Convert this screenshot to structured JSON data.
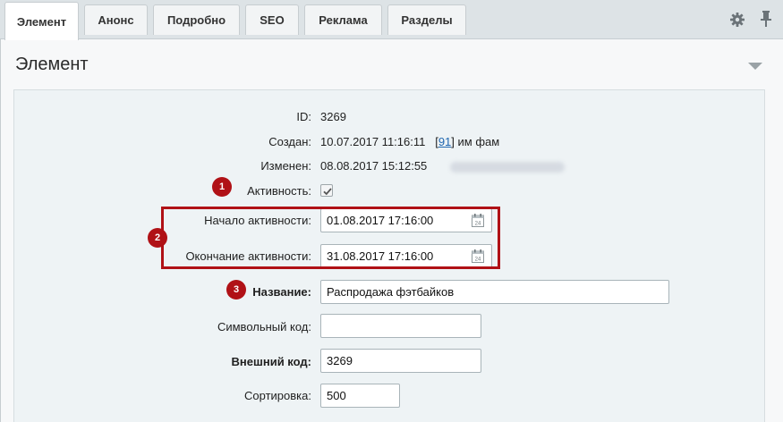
{
  "tabs": [
    {
      "label": "Элемент",
      "active": true
    },
    {
      "label": "Анонс"
    },
    {
      "label": "Подробно"
    },
    {
      "label": "SEO"
    },
    {
      "label": "Реклама"
    },
    {
      "label": "Разделы"
    }
  ],
  "icons": {
    "settings": "gear-icon",
    "pin": "pin-icon",
    "calendar": "calendar-icon",
    "collapse": "triangle-down-icon"
  },
  "section": {
    "title": "Элемент"
  },
  "fields": {
    "id": {
      "label": "ID:",
      "value": "3269"
    },
    "created": {
      "label": "Создан:",
      "value": "10.07.2017 11:16:11",
      "user_id": "91",
      "user_name": "им фам"
    },
    "modified": {
      "label": "Изменен:",
      "value": "08.08.2017 15:12:55"
    },
    "active": {
      "label": "Активность:",
      "checked": true
    },
    "active_from": {
      "label": "Начало активности:",
      "value": "01.08.2017 17:16:00"
    },
    "active_to": {
      "label": "Окончание активности:",
      "value": "31.08.2017 17:16:00"
    },
    "name": {
      "label": "Название:",
      "value": "Распродажа фэтбайков"
    },
    "code": {
      "label": "Символьный код:",
      "value": ""
    },
    "xml_id": {
      "label": "Внешний код:",
      "value": "3269"
    },
    "sort": {
      "label": "Сортировка:",
      "value": "500"
    }
  },
  "markers": [
    "1",
    "2",
    "3"
  ],
  "colors": {
    "highlight": "#b01116",
    "link": "#2067b0"
  }
}
